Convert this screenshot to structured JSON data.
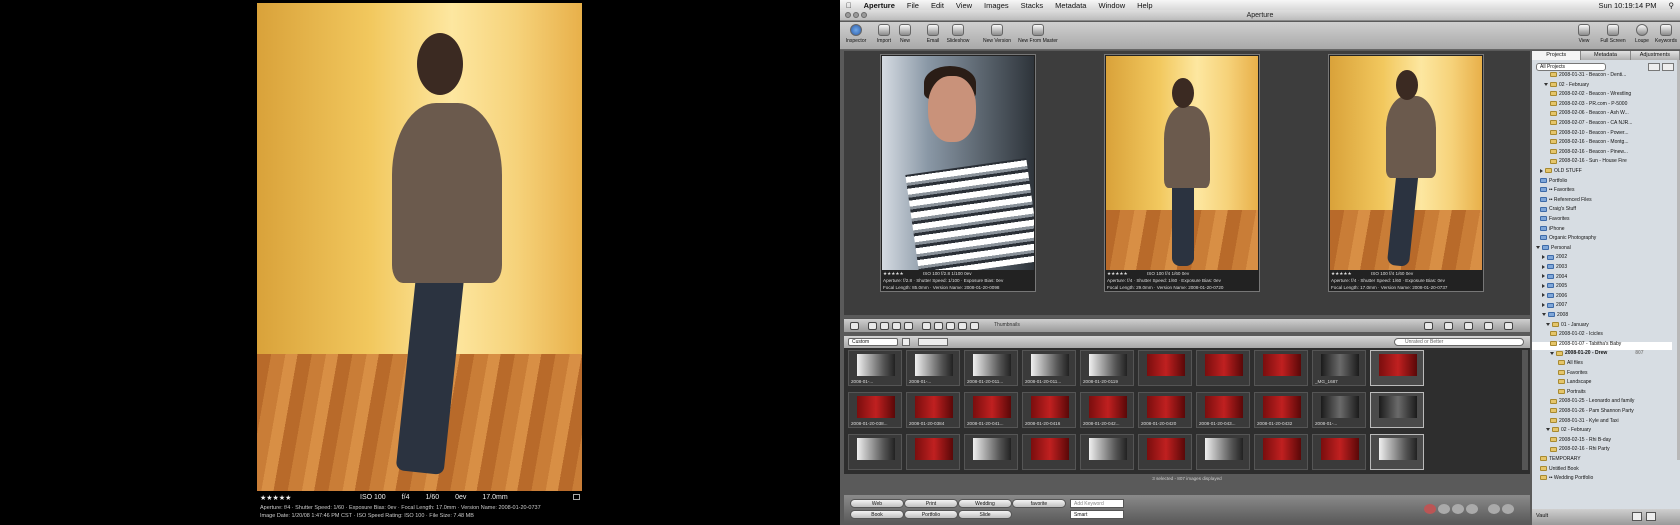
{
  "left_preview": {
    "rating": "★★★★★",
    "iso": "ISO 100",
    "aperture": "f/4",
    "shutter": "1/60",
    "ev": "0ev",
    "focal": "17.0mm",
    "line1": "Aperture: f/4 · Shutter Speed: 1/60 · Exposure Bias: 0ev · Focal Length: 17.0mm · Version Name: 2008-01-20-0737",
    "line2": "Image Date: 1/20/08 1:47:46 PM CST · ISO Speed Rating: ISO 100 · File Size: 7.48 MB"
  },
  "menubar": {
    "app": "Aperture",
    "items": [
      "File",
      "Edit",
      "View",
      "Images",
      "Stacks",
      "Metadata",
      "Window",
      "Help"
    ],
    "clock": "Sun 10:19:14 PM"
  },
  "window": {
    "title": "Aperture"
  },
  "toolbar": {
    "inspector": "Inspector",
    "import": "Import",
    "new": "New",
    "email": "Email",
    "slideshow": "Slideshow",
    "new_version": "New Version",
    "new_from_master": "New From Master",
    "view": "View",
    "full_screen": "Full Screen",
    "loupe": "Loupe",
    "keywords": "Keywords"
  },
  "viewer": {
    "images": [
      {
        "rating": "★★★★★",
        "meta1": "ISO 100  f/2.8  1/100  0ev",
        "meta2": "Aperture: f/2.8 · Shutter Speed: 1/100 · Exposure Bias: 0ev",
        "meta3": "Focal Length: 85.0mm · Version Name: 2008-01-20-0098"
      },
      {
        "rating": "★★★★★",
        "meta1": "ISO 100  f/4  1/60  0ev",
        "meta2": "Aperture: f/4 · Shutter Speed: 1/60 · Exposure Bias: 0ev",
        "meta3": "Focal Length: 29.0mm · Version Name: 2008-01-20-0720"
      },
      {
        "rating": "★★★★★",
        "meta1": "ISO 100  f/4  1/60  0ev",
        "meta2": "Aperture: f/4 · Shutter Speed: 1/60 · Exposure Bias: 0ev",
        "meta3": "Focal Length: 17.0mm · Version Name: 2008-01-20-0737"
      }
    ],
    "thumbnails_label": "Thumbnails"
  },
  "browser": {
    "preset": "Custom",
    "filter_placeholder": "Unrated or Better",
    "status": "3 selected - 807 images displayed",
    "row1": [
      "2008-01-...",
      "2008-01-...",
      "2008-01-20-011...",
      "2008-01-20-011...",
      "2008-01-20-0119",
      "",
      "",
      "",
      "_MG_1687",
      ""
    ],
    "row2": [
      "2008-01-20-038...",
      "2008-01-20-0384",
      "2008-01-20-041...",
      "2008-01-20-0416",
      "2008-01-20-042...",
      "2008-01-20-0420",
      "2008-01-20-043...",
      "2008-01-20-0432",
      "2008-01-...",
      ""
    ]
  },
  "bottom": {
    "web": "Web",
    "print": "Print",
    "wedding": "Wedding",
    "favorite": "favorite",
    "book": "Book",
    "portfolio": "Portfolio",
    "slide": "Slide",
    "keyword_placeholder": "Add Keyword",
    "smart": "Smart"
  },
  "panel": {
    "tabs": [
      "Projects",
      "Metadata",
      "Adjustments"
    ],
    "filter": "All Projects",
    "tree": [
      "2008-01-31 - Beacon - Denti...",
      "02 - February",
      "2008-02-02 - Beacon - Wrestling",
      "2008-02-03 - PR.com - P-5000",
      "2008-02-06 - Beacon - Ash W...",
      "2008-02-07 - Beacon - CA NJR...",
      "2008-02-10 - Beacon - Power...",
      "2008-02-16 - Beacon - Montg...",
      "2008-02-16 - Beacon - Pinew...",
      "2008-02-16 - Sun - House Fire",
      "OLD STUFF",
      "Portfolio",
      "•• Favorites",
      "•• Referenced Files",
      "Craig's Stuff",
      "Favorites",
      "iPhone",
      "Organic Photography",
      "Personal",
      "2002",
      "2003",
      "2004",
      "2005",
      "2006",
      "2007",
      "2008",
      "01 - January",
      "2008-01-02 - Icicles",
      "2008-01-07 - Tabitha's Baby",
      "2008-01-20 - Drew",
      "All files",
      "Favorites",
      "Landscape",
      "Portraits",
      "2008-01-25 - Leonardo and family",
      "2008-01-26 - Pam Shannon Party",
      "2008-01-31 - Kyle and Taxi",
      "02 - February",
      "2008-02-15 - Rhi B-day",
      "2008-02-16 - Rhi Party",
      "TEMPORARY",
      "Untitled Book",
      "•• Wedding Portfolio"
    ],
    "drew_count": "807",
    "vault": "Vault"
  }
}
